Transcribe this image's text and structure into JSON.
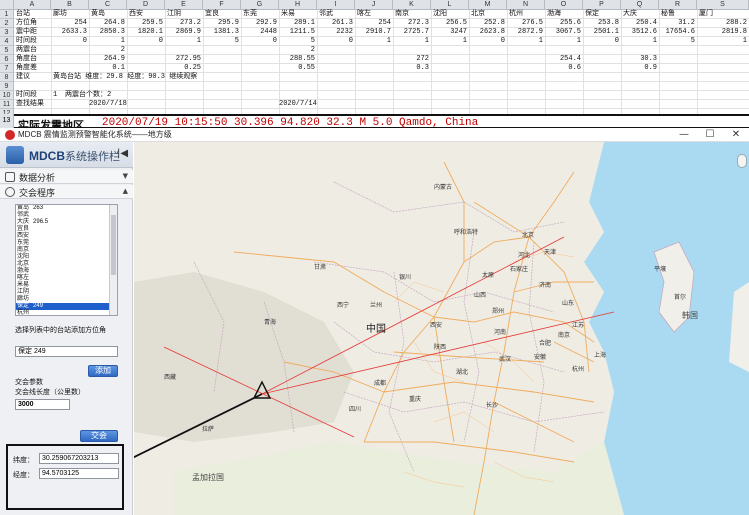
{
  "spreadsheet": {
    "columns": [
      "A",
      "B",
      "C",
      "D",
      "E",
      "F",
      "G",
      "H",
      "I",
      "J",
      "K",
      "L",
      "M",
      "N",
      "O",
      "P",
      "Q",
      "R",
      "S"
    ],
    "row_numbers": [
      "1",
      "2",
      "3",
      "4",
      "5",
      "6",
      "7",
      "8",
      "9",
      "10",
      "11",
      "12"
    ],
    "row1": [
      "台站",
      "廊坊",
      "黄岛",
      "西安",
      "江阴",
      "宜良",
      "东莞",
      "米易",
      "邻武",
      "喀左",
      "南京",
      "沈阳",
      "北京",
      "杭州",
      "渤海",
      "保定",
      "大庆",
      "秘鲁",
      "厦门"
    ],
    "row2": [
      "方位角",
      "254",
      "264.8",
      "259.5",
      "273.2",
      "295.9",
      "292.9",
      "289.1",
      "261.3",
      "254",
      "272.3",
      "256.5",
      "252.8",
      "276.5",
      "255.6",
      "253.8",
      "250.4",
      "31.2",
      "288.2"
    ],
    "row3": [
      "震中距",
      "2633.3",
      "2850.3",
      "1820.1",
      "2869.9",
      "1381.3",
      "2448",
      "1211.5",
      "2232",
      "2910.7",
      "2725.7",
      "3247",
      "2623.8",
      "2872.9",
      "3067.5",
      "2501.1",
      "3512.6",
      "17654.6",
      "2819.8"
    ],
    "row4": [
      "时间段",
      "0",
      "1",
      "0",
      "1",
      "5",
      "0",
      "5",
      "0",
      "1",
      "1",
      "1",
      "0",
      "1",
      "1",
      "0",
      "1",
      "5",
      "1"
    ],
    "row5_label": "两震台",
    "row5_c": "2",
    "row5_h": "2",
    "row6_label": "角度台",
    "row6_c": "264.9",
    "row6_e": "272.95",
    "row6_h": "288.55",
    "row6_k": "272",
    "row6_o": "254.4",
    "row6_q": "30.3",
    "row7_label": "角度差",
    "row7_c": "0.1",
    "row7_e": "0.25",
    "row7_h": "0.55",
    "row7_k": "0.3",
    "row7_o": "0.6",
    "row7_q": "0.9",
    "row8_label": "建议",
    "row8_text": "黄岛台站 维度：29.8 经度：90.3 继续观察",
    "row10_label": "时间段",
    "row10_b": "1",
    "row10_text": "两震台个数：2",
    "row11_label": "查找结果",
    "row11_c": "2020/7/18",
    "row11_h": "2020/7/14",
    "row13_number": "13",
    "row13_label": "实际发震地区",
    "row13_info": "2020/07/19 10:15:50 30.396 94.820 32.3 M 5.0 Qamdo, China"
  },
  "window": {
    "title": "MDCB 震情监测预警智能化系统——地方级",
    "minimize": "—",
    "maximize": "☐",
    "close": "✕"
  },
  "panel": {
    "brand": "MDCB",
    "brand_suffix": "系统操作栏",
    "collapse": "|◀",
    "section1": "数据分析",
    "section2": "交会程序",
    "stations": [
      {
        "name": "黄岛",
        "value": "263"
      },
      {
        "name": "邻武",
        "value": ""
      },
      {
        "name": "大庆",
        "value": "296.5"
      },
      {
        "name": "宜良",
        "value": ""
      },
      {
        "name": "西安",
        "value": ""
      },
      {
        "name": "东莞",
        "value": ""
      },
      {
        "name": "南京",
        "value": ""
      },
      {
        "name": "沈阳",
        "value": ""
      },
      {
        "name": "北京",
        "value": ""
      },
      {
        "name": "渤海",
        "value": ""
      },
      {
        "name": "喀左",
        "value": ""
      },
      {
        "name": "米易",
        "value": ""
      },
      {
        "name": "江阴",
        "value": ""
      },
      {
        "name": "廊坊",
        "value": ""
      },
      {
        "name": "保定",
        "value": "249"
      },
      {
        "name": "杭州",
        "value": ""
      },
      {
        "name": "秘鲁",
        "value": ""
      },
      {
        "name": "厦门",
        "value": ""
      }
    ],
    "selected_index": 14,
    "hint": "选择列表中的台站添加方位角",
    "selected_value": "保定 249",
    "add_button": "添加",
    "params_label": "交会参数",
    "length_label": "交会线长度（公里数）",
    "length_value": "3000",
    "intersect_button": "交会",
    "lat_label": "纬度：",
    "lat_value": "30.259067203213",
    "lon_label": "经度：",
    "lon_value": "94.5703125"
  },
  "map": {
    "labels": {
      "china": "中国",
      "beijing": "北京",
      "tianjin": "天津",
      "shijiazhuang": "石家庄",
      "taiyuan": "太原",
      "jinan": "济南",
      "hohhot": "呼和浩特",
      "yinchuan": "银川",
      "lanzhou": "兰州",
      "xining": "西宁",
      "xian": "西安",
      "zhengzhou": "郑州",
      "hefei": "合肥",
      "nanjing": "南京",
      "shanghai": "上海",
      "hangzhou": "杭州",
      "wuhan": "武汉",
      "chongqing": "重庆",
      "chengdu": "成都",
      "changsha": "长沙",
      "lhasa": "拉萨",
      "bangladesh": "孟加拉国",
      "seoul": "首尔",
      "pyongyang": "平壤",
      "korea": "韩国",
      "shandong": "山东",
      "henan": "河南",
      "hubei": "湖北",
      "sichuan": "四川",
      "mongolia_inner": "内蒙古",
      "qinghai": "青海",
      "gansu": "甘肃",
      "xizang": "西藏",
      "anhui": "安徽",
      "jiangsu": "江苏",
      "shaanxi": "陕西",
      "shanxi": "山西",
      "hebei": "河北"
    }
  }
}
